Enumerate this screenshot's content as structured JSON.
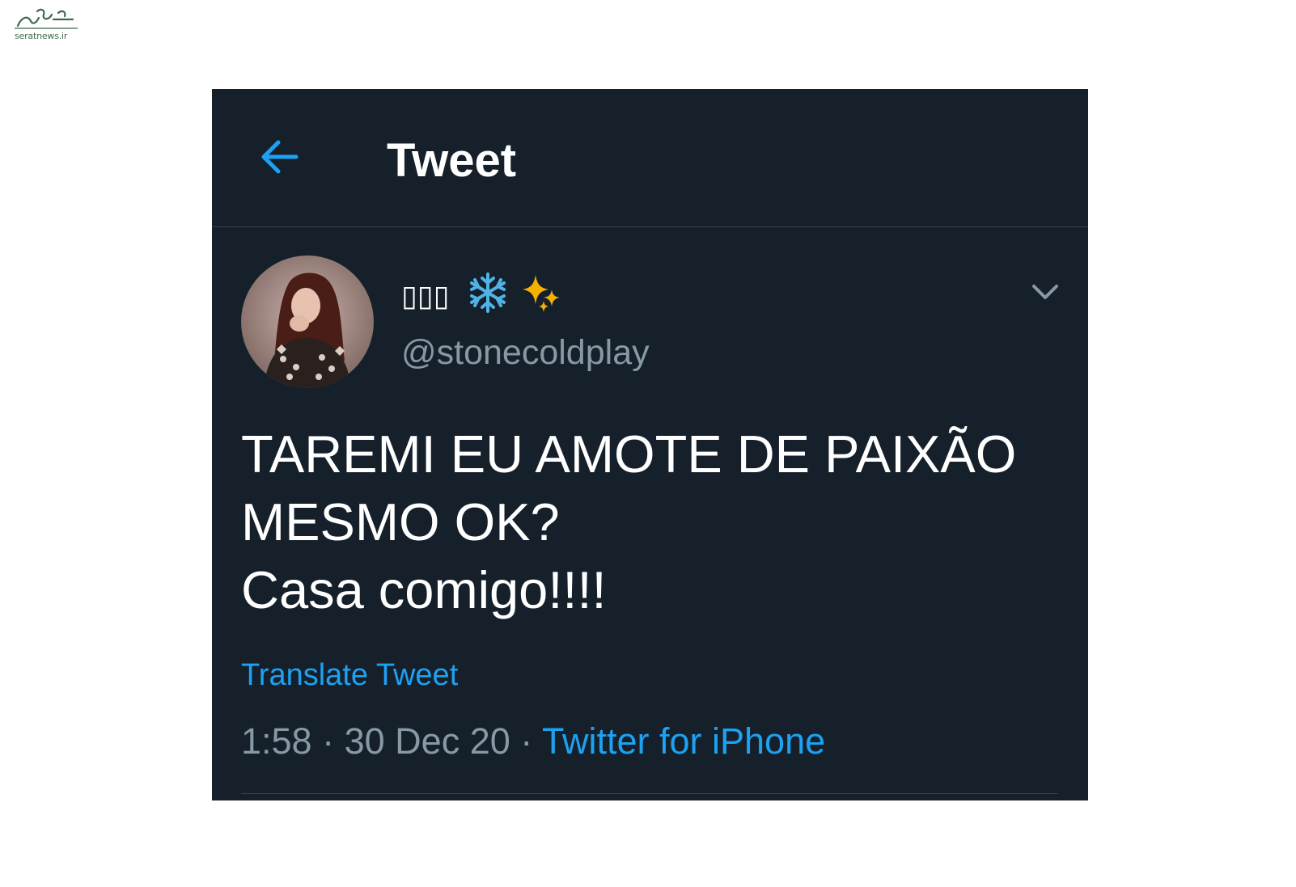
{
  "watermark": {
    "text": "seratnews.ir"
  },
  "header": {
    "title": "Tweet",
    "back_icon": "arrow-left-icon"
  },
  "tweet": {
    "display_name": "▯▯▯",
    "name_emojis": [
      "snowflake-emoji",
      "sparkles-emoji"
    ],
    "handle": "@stonecoldplay",
    "text": "TAREMI EU AMOTE DE PAIXÃO\nMESMO OK?\nCasa comigo!!!!",
    "translate_label": "Translate Tweet",
    "time": "1:58",
    "date": "30 Dec 20",
    "source": "Twitter for iPhone",
    "separator": "·",
    "caret_icon": "chevron-down-icon"
  },
  "colors": {
    "background": "#15202b",
    "accent": "#1da1f2",
    "secondary_text": "#8899a6",
    "divider": "#38444d"
  }
}
